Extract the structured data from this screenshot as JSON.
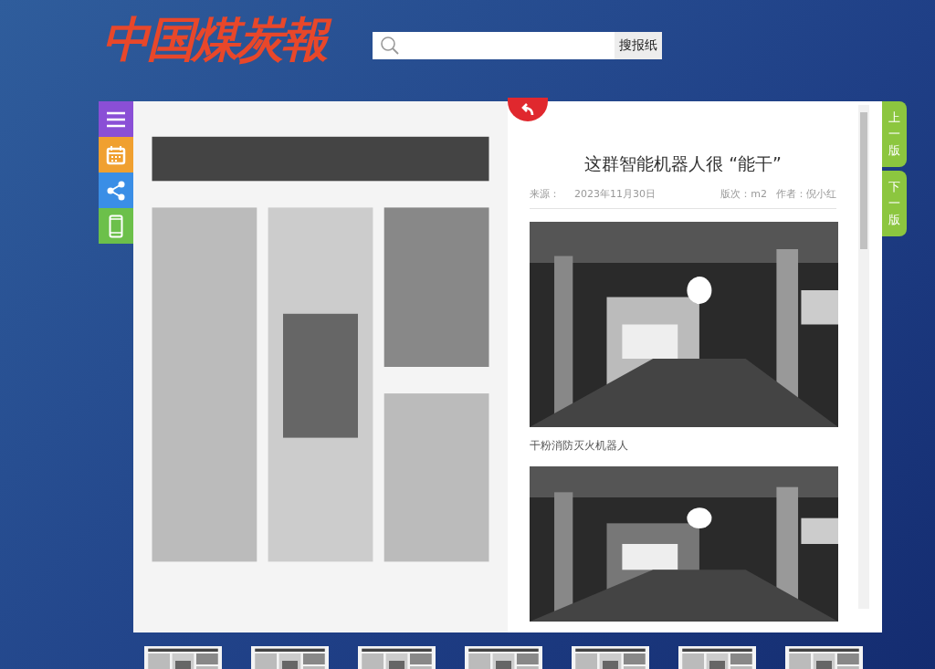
{
  "header": {
    "logo": "中国煤炭報",
    "search": {
      "button": "搜报纸"
    }
  },
  "toolbar": [
    {
      "kind": "menu",
      "color": "#8a4fd6"
    },
    {
      "kind": "calendar",
      "color": "#f0a030"
    },
    {
      "kind": "share",
      "color": "#3a8ee6"
    },
    {
      "kind": "mobile",
      "color": "#6cc04a"
    }
  ],
  "page_image": {
    "kind": "picture"
  },
  "article": {
    "title": "这群智能机器人很 “能干”",
    "source_label": "来源：",
    "date": "2023年11月30日",
    "edition": "版次：m2",
    "author": "作者：倪小红",
    "figures": [
      {
        "kind": "picture",
        "caption": "干粉消防灭火机器人"
      },
      {
        "kind": "picture"
      }
    ]
  },
  "page_nav": [
    {
      "label": "上一版"
    },
    {
      "label": "下一版"
    }
  ],
  "thumbnails": [
    {
      "kind": "picture"
    },
    {
      "kind": "picture"
    },
    {
      "kind": "picture"
    },
    {
      "kind": "picture"
    },
    {
      "kind": "picture"
    },
    {
      "kind": "picture"
    },
    {
      "kind": "picture"
    }
  ]
}
